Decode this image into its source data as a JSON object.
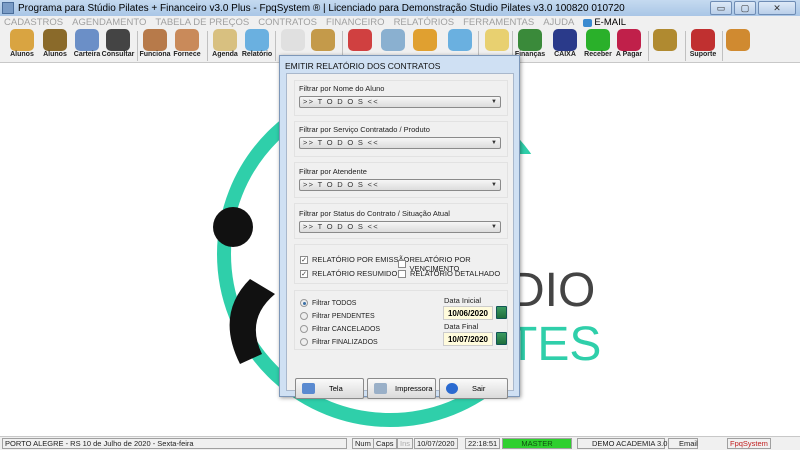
{
  "window": {
    "title": "Programa para Stúdio Pilates + Financeiro v3.0 Plus - FpqSystem ® | Licenciado para  Demonstração Studio Pilates v3.0 100820 010720",
    "min": "▭",
    "max": "▢",
    "close": "✕"
  },
  "menu": [
    "CADASTROS",
    "AGENDAMENTO",
    "TABELA DE PREÇOS",
    "CONTRATOS",
    "FINANCEIRO",
    "RELATÓRIOS",
    "FERRAMENTAS",
    "AJUDA"
  ],
  "menu_email": "E-MAIL",
  "toolbar": [
    {
      "label": "Alunos",
      "color": "#d9a441"
    },
    {
      "label": "Alunos",
      "color": "#8a6a2a"
    },
    {
      "label": "Carteira",
      "color": "#6b8fc7"
    },
    {
      "label": "Consultar",
      "color": "#444444"
    },
    {
      "label": "Funciona",
      "color": "#b77a4a"
    },
    {
      "label": "Fornece",
      "color": "#c98a5a"
    },
    {
      "label": "Agenda",
      "color": "#d8c080"
    },
    {
      "label": "Relatório",
      "color": "#6ab0e0"
    },
    {
      "label": "",
      "color": "#e0e0e0"
    },
    {
      "label": "",
      "color": "#c49a4a"
    },
    {
      "label": "",
      "color": "#d04040"
    },
    {
      "label": "",
      "color": "#8ab0d0"
    },
    {
      "label": "",
      "color": "#e0a030"
    },
    {
      "label": "",
      "color": "#6ab0e0"
    },
    {
      "label": "",
      "color": "#e8d070"
    },
    {
      "label": "Finanças",
      "color": "#3a8a3a"
    },
    {
      "label": "CAIXA",
      "color": "#2a3a8a"
    },
    {
      "label": "Receber",
      "color": "#2ab02a"
    },
    {
      "label": "A Pagar",
      "color": "#c0204a"
    },
    {
      "label": "",
      "color": "#b08a30"
    },
    {
      "label": "Suporte",
      "color": "#c03030"
    },
    {
      "label": "",
      "color": "#d08a30"
    }
  ],
  "logo": {
    "text_top": "DIO",
    "text_bottom": "TES",
    "color": "#2fcfaa"
  },
  "dialog": {
    "title": "EMITIR RELATÓRIO DOS CONTRATOS",
    "filters": [
      {
        "label": "Filtrar por Nome do Aluno",
        "value": ">> T O D O S <<"
      },
      {
        "label": "Filtrar por Serviço Contratado / Produto",
        "value": ">> T O D O S <<"
      },
      {
        "label": "Filtrar por Atendente",
        "value": ">> T O D O S <<"
      },
      {
        "label": "Filtrar por Status do Contrato / Situação Atual",
        "value": ">> T O D O S <<"
      }
    ],
    "checks": [
      {
        "label": "RELATÓRIO POR EMISSÃO",
        "checked": true
      },
      {
        "label": "RELATÓRIO POR VENCIMENTO",
        "checked": false
      },
      {
        "label": "RELATÓRIO RESUMIDO",
        "checked": true
      },
      {
        "label": "RELATÓRIO DETALHADO",
        "checked": false
      }
    ],
    "radios": [
      {
        "label": "Filtrar TODOS",
        "selected": true
      },
      {
        "label": "Filtrar PENDENTES",
        "selected": false
      },
      {
        "label": "Filtrar CANCELADOS",
        "selected": false
      },
      {
        "label": "Filtrar FINALIZADOS",
        "selected": false
      }
    ],
    "date_start_label": "Data Inicial",
    "date_start": "10/06/2020",
    "date_end_label": "Data Final",
    "date_end": "10/07/2020",
    "buttons": {
      "screen": "Tela",
      "printer": "Impressora",
      "exit": "Sair"
    }
  },
  "status": {
    "location": "PORTO ALEGRE - RS 10 de Julho de 2020 - Sexta-feira",
    "num": "Num",
    "caps": "Caps",
    "ins": "Ins",
    "date": "10/07/2020",
    "time": "22:18:51",
    "user": "MASTER",
    "company": "DEMO ACADEMIA 3.0",
    "email": "Email",
    "brand": "FpqSystem"
  }
}
